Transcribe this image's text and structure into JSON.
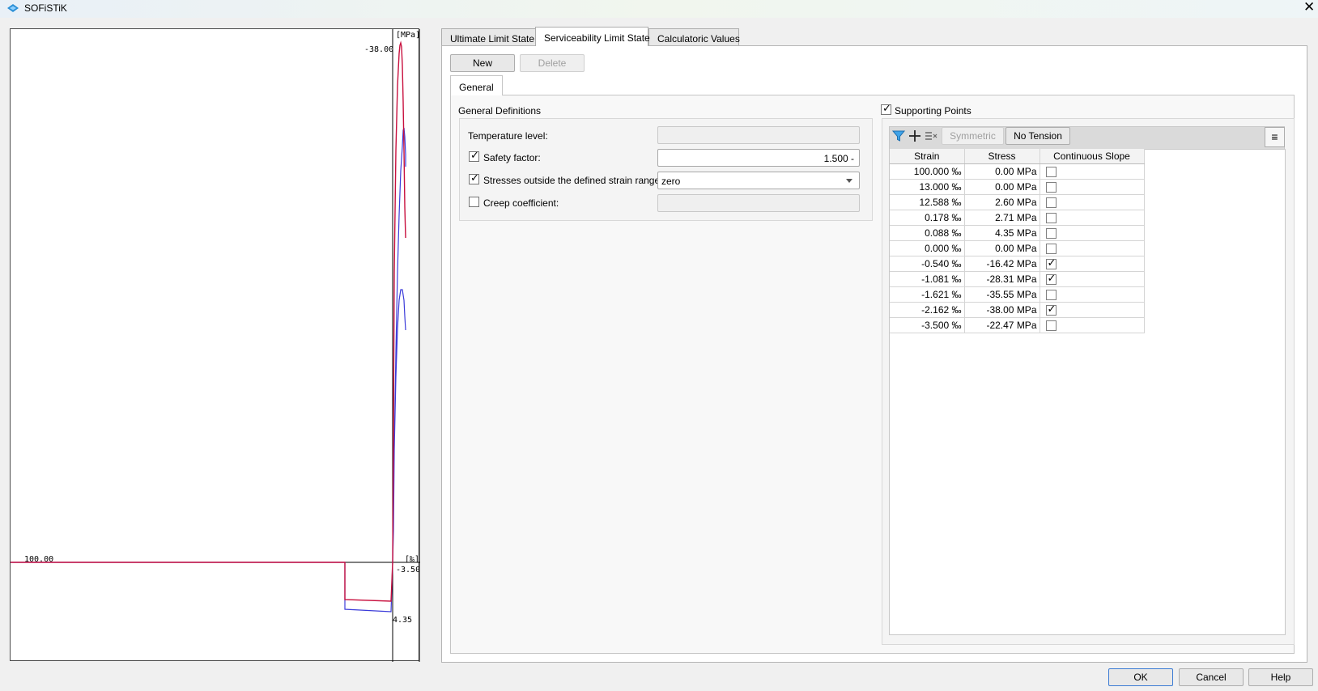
{
  "window": {
    "title": "SOFiSTiK",
    "close_label": "✕"
  },
  "plot": {
    "unit_stress": "[MPa]",
    "unit_strain": "[‰]",
    "label_top_stress": "-38.00",
    "label_left_strain": "100.00",
    "label_right_strain": "-3.50",
    "label_bottom_stress": "4.35",
    "colors": {
      "design_curve": "#c8103e",
      "characteristic_curve": "#3b3bd9",
      "axes": "#000000"
    }
  },
  "tabs": [
    "Ultimate Limit State",
    "Serviceability Limit State",
    "Calculatoric Values"
  ],
  "active_tab": "Serviceability Limit State",
  "buttons": {
    "new": "New",
    "delete": "Delete"
  },
  "subtab": "General",
  "general": {
    "group_title": "General Definitions",
    "temperature_label": "Temperature level:",
    "safety_label": "Safety factor:",
    "safety_checked": true,
    "safety_value": "1.500 -",
    "stresses_label": "Stresses outside the defined strain range:",
    "stresses_checked": true,
    "stresses_value": "zero",
    "creep_label": "Creep coefficient:",
    "creep_checked": false
  },
  "supporting": {
    "title": "Supporting Points",
    "checked": true,
    "toolbar": {
      "filter_icon": "filter-icon",
      "add_icon": "plus-icon",
      "remove_icon": "remove-row-icon",
      "symmetric": "Symmetric",
      "no_tension": "No Tension",
      "menu_icon": "hamburger-menu-icon"
    },
    "columns": [
      "Strain",
      "Stress",
      "Continuous Slope"
    ],
    "rows": [
      {
        "strain": "100.000 ‰",
        "stress": "0.00 MPa",
        "slope": false
      },
      {
        "strain": "13.000 ‰",
        "stress": "0.00 MPa",
        "slope": false
      },
      {
        "strain": "12.588 ‰",
        "stress": "2.60 MPa",
        "slope": false
      },
      {
        "strain": "0.178 ‰",
        "stress": "2.71 MPa",
        "slope": false
      },
      {
        "strain": "0.088 ‰",
        "stress": "4.35 MPa",
        "slope": false
      },
      {
        "strain": "0.000 ‰",
        "stress": "0.00 MPa",
        "slope": false
      },
      {
        "strain": "-0.540 ‰",
        "stress": "-16.42 MPa",
        "slope": true
      },
      {
        "strain": "-1.081 ‰",
        "stress": "-28.31 MPa",
        "slope": true
      },
      {
        "strain": "-1.621 ‰",
        "stress": "-35.55 MPa",
        "slope": false
      },
      {
        "strain": "-2.162 ‰",
        "stress": "-38.00 MPa",
        "slope": true
      },
      {
        "strain": "-3.500 ‰",
        "stress": "-22.47 MPa",
        "slope": false
      }
    ]
  },
  "footer": {
    "ok": "OK",
    "cancel": "Cancel",
    "help": "Help"
  },
  "check_glyph": "✓"
}
